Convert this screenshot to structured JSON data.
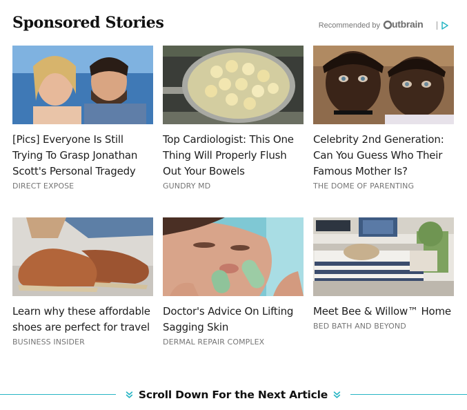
{
  "header": {
    "title": "Sponsored Stories",
    "recommended_by": "Recommended by",
    "brand": "Outbrain",
    "brand_color": "#6d6d6d",
    "adchoice_color": "#27b5c4"
  },
  "cards": [
    {
      "title": "[Pics] Everyone Is Still Trying To Grasp Jonathan Scott's Personal Tragedy",
      "source": "DIRECT EXPOSE",
      "image": "couple-by-water"
    },
    {
      "title": "Top Cardiologist: This One Thing Will Properly Flush Out Your Bowels",
      "source": "GUNDRY MD",
      "image": "boiling-banana-pot"
    },
    {
      "title": "Celebrity 2nd Generation: Can You Guess Who Their Famous Mother Is?",
      "source": "THE DOME OF PARENTING",
      "image": "two-children"
    },
    {
      "title": "Learn why these affordable shoes are perfect for travel",
      "source": "BUSINESS INSIDER",
      "image": "espadrille-shoes"
    },
    {
      "title": "Doctor's Advice On Lifting Sagging Skin",
      "source": "DERMAL REPAIR COMPLEX",
      "image": "jade-face-roller"
    },
    {
      "title": "Meet Bee & Willow™ Home",
      "source": "BED BATH AND BEYOND",
      "image": "striped-daybed-with-dog"
    }
  ],
  "footer": {
    "scroll_label": "Scroll Down For the Next Article",
    "accent_color": "#27b5c4"
  }
}
